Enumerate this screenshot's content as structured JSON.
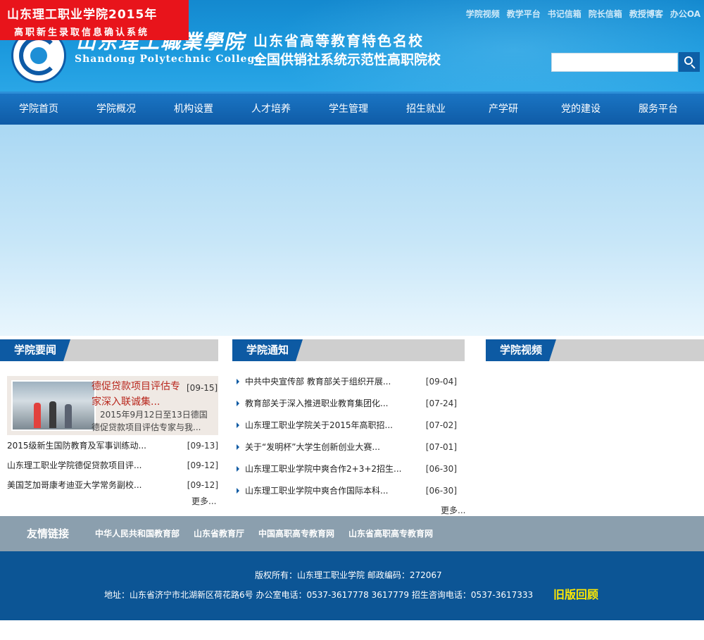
{
  "promo": {
    "line1": "山东理工职业学院2015年",
    "line2": "高职新生录取信息确认系统"
  },
  "logo": {
    "name_cn": "山东理工職業學院",
    "name_en": "Shandong Polytechnic College"
  },
  "slogan": {
    "line1": "山东省高等教育特色名校",
    "line2": "全国供销社系统示范性高职院校"
  },
  "toplinks": [
    "学院视频",
    "教学平台",
    "书记信箱",
    "院长信箱",
    "教授博客",
    "办公OA"
  ],
  "search": {
    "value": ""
  },
  "nav": [
    "学院首页",
    "学院概况",
    "机构设置",
    "人才培养",
    "学生管理",
    "招生就业",
    "产学研",
    "党的建设",
    "服务平台"
  ],
  "news": {
    "title": "学院要闻",
    "featured": {
      "title": "德促贷款项目评估专家深入联诚集...",
      "date": "[09-15]",
      "summary": "2015年9月12日至13日德国德促贷款项目评估专家与我..."
    },
    "items": [
      {
        "title": "2015级新生国防教育及军事训练动...",
        "date": "[09-13]"
      },
      {
        "title": "山东理工职业学院德促贷款项目评...",
        "date": "[09-12]"
      },
      {
        "title": "美国芝加哥康考迪亚大学常务副校...",
        "date": "[09-12]"
      }
    ],
    "more": "更多..."
  },
  "notice": {
    "title": "学院通知",
    "items": [
      {
        "title": "中共中央宣传部 教育部关于组织开展...",
        "date": "[09-04]"
      },
      {
        "title": "教育部关于深入推进职业教育集团化...",
        "date": "[07-24]"
      },
      {
        "title": "山东理工职业学院关于2015年高职招...",
        "date": "[07-02]"
      },
      {
        "title": "关于“发明杯”大学生创新创业大赛...",
        "date": "[07-01]"
      },
      {
        "title": "山东理工职业学院中爽合作2+3+2招生...",
        "date": "[06-30]"
      },
      {
        "title": "山东理工职业学院中爽合作国际本科...",
        "date": "[06-30]"
      }
    ],
    "more": "更多..."
  },
  "video": {
    "title": "学院视频"
  },
  "friends": {
    "label": "友情链接",
    "links": [
      "中华人民共和国教育部",
      "山东省教育厅",
      "中国高职高专教育网",
      "山东省高职高专教育网"
    ]
  },
  "footer": {
    "line1": "版权所有：山东理工职业学院 邮政编码：272067",
    "line2": "地址：山东省济宁市北湖新区荷花路6号 办公室电话：0537-3617778 3617779 招生咨询电话：0537-3617333",
    "old_version": "旧版回顾"
  }
}
